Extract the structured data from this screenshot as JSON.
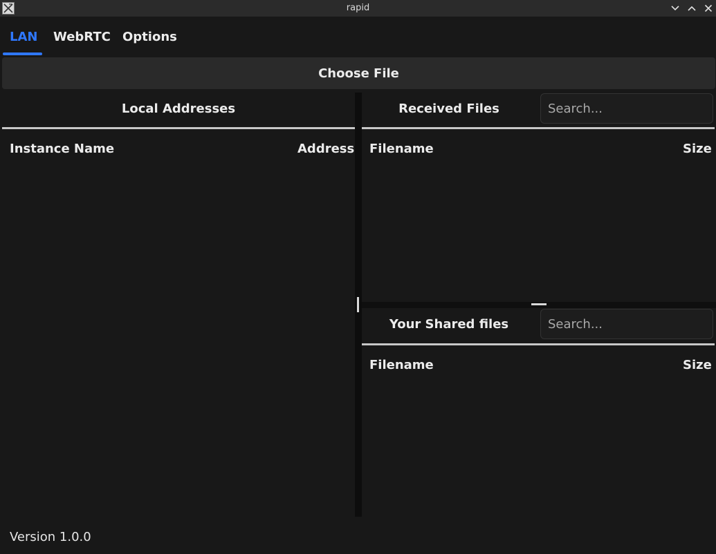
{
  "window": {
    "title": "rapid",
    "icon": "x-app-icon",
    "controls": [
      "minimize-icon",
      "maximize-icon",
      "close-icon"
    ]
  },
  "tabs": [
    {
      "label": "LAN",
      "active": true
    },
    {
      "label": "WebRTC",
      "active": false
    },
    {
      "label": "Options",
      "active": false
    }
  ],
  "accent_color": "#2f78ff",
  "choose_file": {
    "label": "Choose File"
  },
  "local_addresses": {
    "title": "Local Addresses",
    "columns": [
      "Instance Name",
      "Address"
    ],
    "rows": []
  },
  "received_files": {
    "title": "Received Files",
    "search_placeholder": "Search...",
    "columns": [
      "Filename",
      "Size"
    ],
    "rows": []
  },
  "shared_files": {
    "title": "Your Shared files",
    "search_placeholder": "Search...",
    "columns": [
      "Filename",
      "Size"
    ],
    "rows": []
  },
  "footer": {
    "version": "Version 1.0.0"
  }
}
